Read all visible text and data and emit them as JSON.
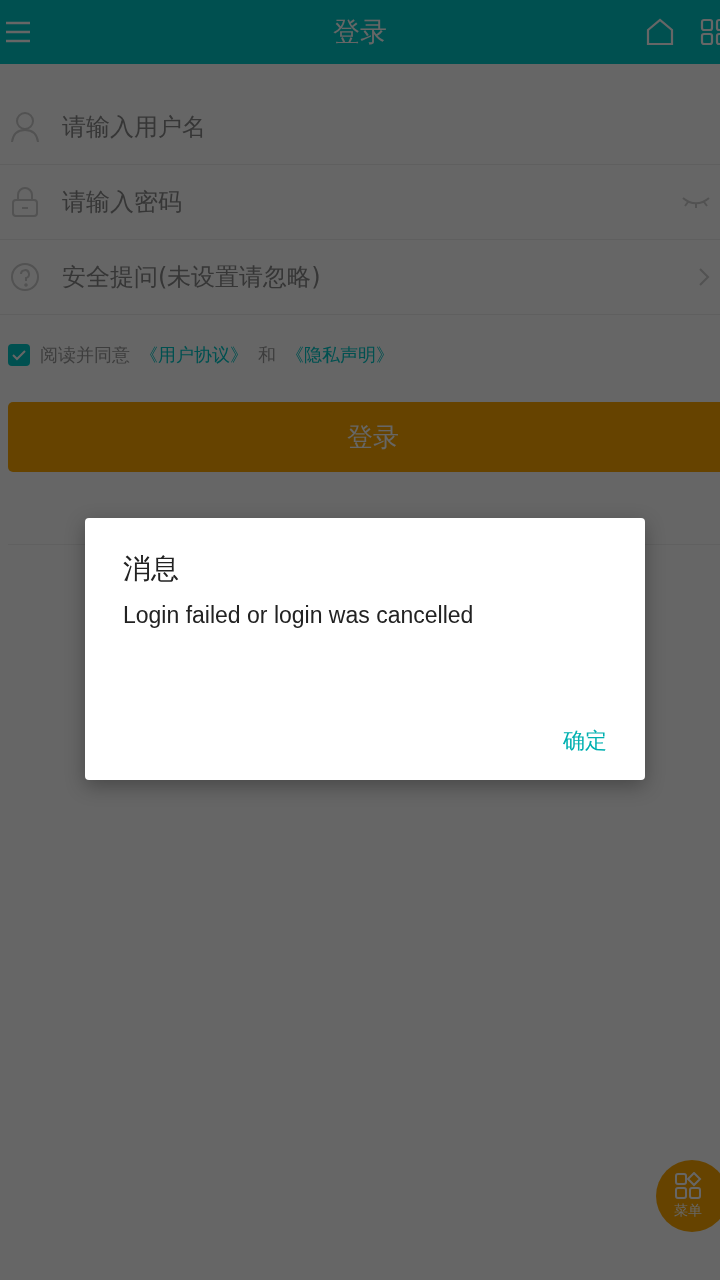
{
  "header": {
    "title": "登录"
  },
  "fields": [
    {
      "kind": "text",
      "placeholder": "请输入用户名"
    },
    {
      "kind": "password",
      "placeholder": "请输入密码"
    },
    {
      "kind": "select",
      "placeholder": "安全提问(未设置请忽略)"
    }
  ],
  "agreement": {
    "checked": true,
    "prefix": "阅读并同意",
    "link_1": "《用户协议》",
    "joiner": "和",
    "link_2": "《隐私声明》"
  },
  "login_button": "登录",
  "dialog": {
    "title": "消息",
    "message": "Login failed or login was cancelled",
    "ok": "确定"
  },
  "menu_fab": {
    "label": "菜单"
  }
}
